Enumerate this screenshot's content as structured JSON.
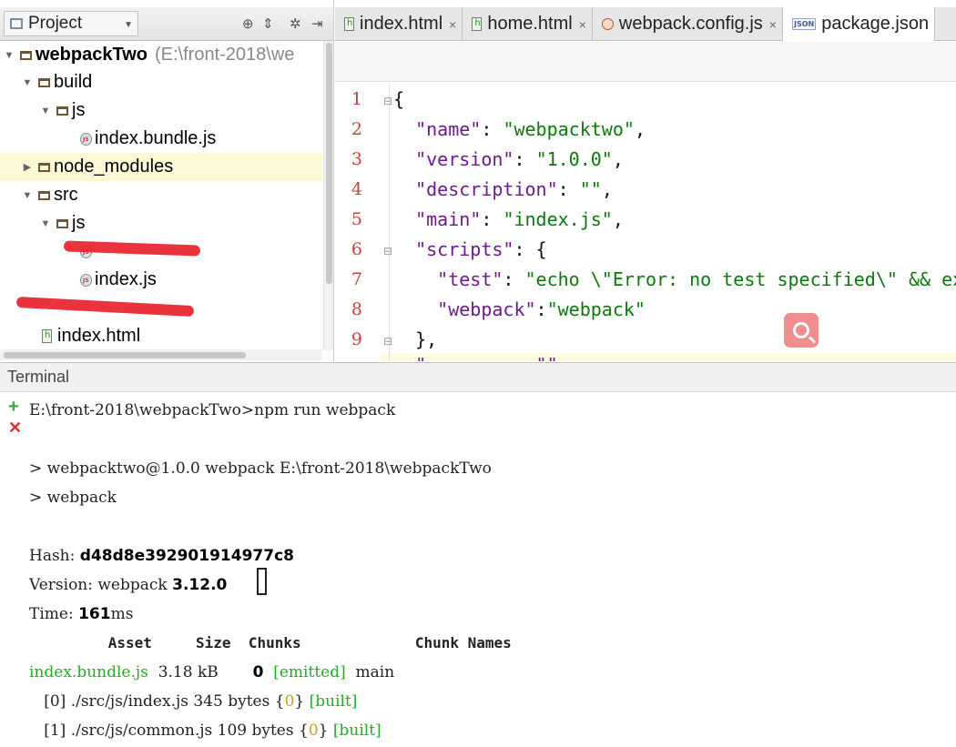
{
  "project": {
    "dropdown_label": "Project",
    "tree": {
      "root_name": "webpackTwo",
      "root_path": "(E:\\front-2018\\we",
      "build": "build",
      "build_js": "js",
      "bundle_file": "index.bundle.js",
      "node_modules": "node_modules",
      "src": "src",
      "src_js": "js",
      "src_index_js": "index.js",
      "index_html": "index.html"
    }
  },
  "editor": {
    "tabs": [
      {
        "label": "index.html",
        "icon": "html-file-icon"
      },
      {
        "label": "home.html",
        "icon": "html-file-icon"
      },
      {
        "label": "webpack.config.js",
        "icon": "webpack-file-icon"
      },
      {
        "label": "package.json",
        "icon": "json-file-icon"
      }
    ],
    "json_badge": "JSON",
    "close_glyph": "×",
    "lines": {
      "l1": "{",
      "l2_key": "\"name\"",
      "l2_val": "\"webpacktwo\"",
      "l3_key": "\"version\"",
      "l3_val": "\"1.0.0\"",
      "l4_key": "\"description\"",
      "l4_val": "\"\"",
      "l5_key": "\"main\"",
      "l5_val": "\"index.js\"",
      "l6_key": "\"scripts\"",
      "l7_key": "\"test\"",
      "l7_val": "\"echo \\\"Error: no test specified\\\" && exi",
      "l8_key": "\"webpack\"",
      "l8_val": "\"webpack\"",
      "l9": "},",
      "l10": "\"          \"\""
    },
    "line_numbers": [
      "1",
      "2",
      "3",
      "4",
      "5",
      "6",
      "7",
      "8",
      "9"
    ]
  },
  "terminal": {
    "title": "Terminal",
    "cmd": "E:\\front-2018\\webpackTwo>npm run webpack",
    "run1": "> webpacktwo@1.0.0 webpack E:\\front-2018\\webpackTwo",
    "run2": "> webpack",
    "hash_label": "Hash: ",
    "hash_value": "d48d8e392901914977c8",
    "version_label": "Version: webpack ",
    "version_value": "3.12.0",
    "time_label": "Time: ",
    "time_value": "161",
    "time_unit": "ms",
    "table_header": "         Asset     Size  Chunks             Chunk Names",
    "asset_name": "index.bundle.js",
    "asset_size": "  3.18 kB       ",
    "asset_chunk": "0",
    "asset_status": "[emitted]",
    "asset_chunkname": "main",
    "mod0_prefix": "   [0] ./src/js/index.js 345 bytes ",
    "mod1_prefix": "   [1] ./src/js/common.js 109 bytes ",
    "mod_open": "{",
    "mod_id0": "0",
    "mod_id1": "0",
    "mod_close": "}",
    "mod_built": "[built]"
  },
  "colors": {
    "gutter_number": "#c4413a",
    "json_key": "#6d1a8c",
    "json_string": "#0b7a0b",
    "terminal_green": "#1fae1f",
    "redaction": "#e8242e"
  }
}
